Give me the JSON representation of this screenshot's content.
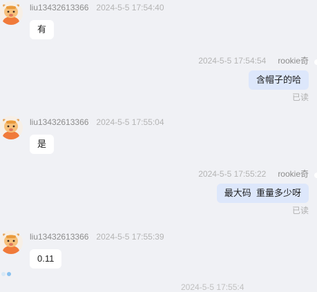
{
  "chat": {
    "messages": [
      {
        "side": "left",
        "sender": "liu13432613366",
        "time": "2024-5-5 17:54:40",
        "text": "有"
      },
      {
        "side": "right",
        "sender": "rookie奇",
        "time": "2024-5-5 17:54:54",
        "text": "含帽子的哈",
        "status": "已读"
      },
      {
        "side": "left",
        "sender": "liu13432613366",
        "time": "2024-5-5 17:55:04",
        "text": "是"
      },
      {
        "side": "right",
        "sender": "rookie奇",
        "time": "2024-5-5 17:55:22",
        "text": "最大码  重量多少呀",
        "status": "已读"
      },
      {
        "side": "left",
        "sender": "liu13432613366",
        "time": "2024-5-5 17:55:39",
        "text": "0.11"
      }
    ],
    "avatar_icon": "cartoon-horned-character-icon",
    "partial_next_line": "2024-5-5 17:55:4",
    "loading_icon": "loading-dots-icon"
  },
  "colors": {
    "page_background": "#f0f1f5",
    "incoming_bubble": "#ffffff",
    "outgoing_bubble": "#dde7fb",
    "loading_dot_1": "#d6e8f7",
    "loading_dot_2": "#89c1ef"
  }
}
